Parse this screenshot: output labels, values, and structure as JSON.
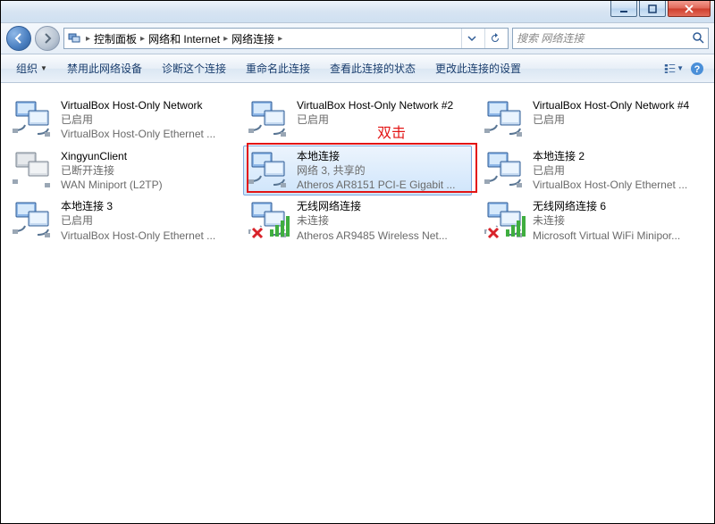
{
  "breadcrumbs": {
    "p0": "控制面板",
    "p1": "网络和 Internet",
    "p2": "网络连接"
  },
  "search": {
    "placeholder": "搜索 网络连接"
  },
  "toolbar": {
    "organize": "组织",
    "disable": "禁用此网络设备",
    "diagnose": "诊断这个连接",
    "rename": "重命名此连接",
    "status": "查看此连接的状态",
    "change": "更改此连接的设置"
  },
  "annotation": {
    "text": "双击"
  },
  "items": [
    {
      "name": "VirtualBox Host-Only Network",
      "status": "已启用",
      "device": "VirtualBox Host-Only Ethernet ...",
      "icon": "net",
      "selected": false
    },
    {
      "name": "VirtualBox Host-Only Network #2",
      "status": "已启用",
      "device": "",
      "icon": "net",
      "selected": false
    },
    {
      "name": "VirtualBox Host-Only Network #4",
      "status": "已启用",
      "device": "",
      "icon": "net",
      "selected": false
    },
    {
      "name": "XingyunClient",
      "status": "已断开连接",
      "device": "WAN Miniport (L2TP)",
      "icon": "net-gray",
      "selected": false
    },
    {
      "name": "本地连接",
      "status": "网络  3, 共享的",
      "device": "Atheros AR8151 PCI-E Gigabit ...",
      "icon": "net",
      "selected": true
    },
    {
      "name": "本地连接 2",
      "status": "已启用",
      "device": "VirtualBox Host-Only Ethernet ...",
      "icon": "net",
      "selected": false
    },
    {
      "name": "本地连接 3",
      "status": "已启用",
      "device": "VirtualBox Host-Only Ethernet ...",
      "icon": "net",
      "selected": false
    },
    {
      "name": "无线网络连接",
      "status": "未连接",
      "device": "Atheros AR9485 Wireless Net...",
      "icon": "wifi-x",
      "selected": false
    },
    {
      "name": "无线网络连接 6",
      "status": "未连接",
      "device": "Microsoft Virtual WiFi Minipor...",
      "icon": "wifi-x",
      "selected": false
    }
  ]
}
